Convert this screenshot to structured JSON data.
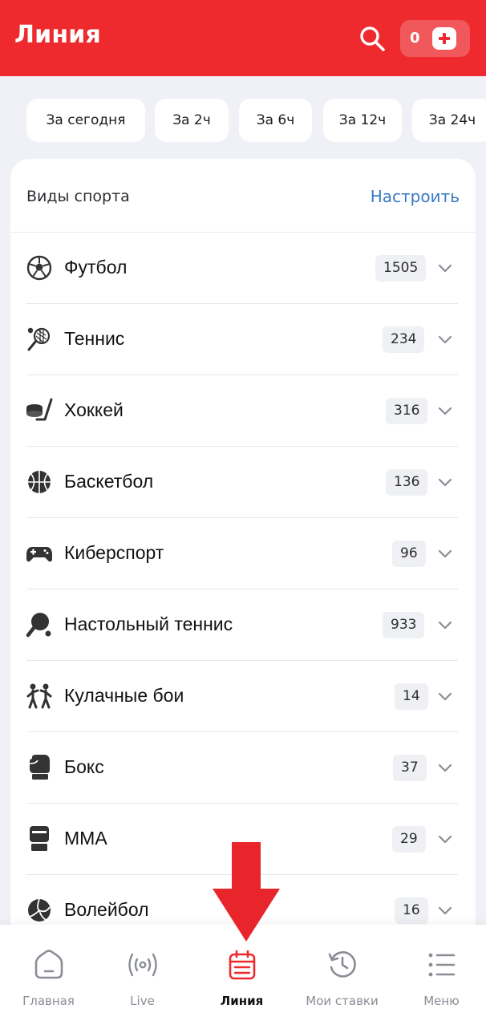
{
  "header": {
    "title": "Линия",
    "balance": "0",
    "accent_color": "#ee2a2e"
  },
  "filters": [
    {
      "label": "За сегодня"
    },
    {
      "label": "За 2ч"
    },
    {
      "label": "За 6ч"
    },
    {
      "label": "За 12ч"
    },
    {
      "label": "За 24ч"
    }
  ],
  "sports_card": {
    "title": "Виды спорта",
    "configure_label": "Настроить",
    "items": [
      {
        "name": "Футбол",
        "count": "1505",
        "icon": "soccer-ball-icon"
      },
      {
        "name": "Теннис",
        "count": "234",
        "icon": "tennis-racket-icon"
      },
      {
        "name": "Хоккей",
        "count": "316",
        "icon": "hockey-icon"
      },
      {
        "name": "Баскетбол",
        "count": "136",
        "icon": "basketball-icon"
      },
      {
        "name": "Киберспорт",
        "count": "96",
        "icon": "gamepad-icon"
      },
      {
        "name": "Настольный теннис",
        "count": "933",
        "icon": "table-tennis-icon"
      },
      {
        "name": "Кулачные бои",
        "count": "14",
        "icon": "fighters-icon"
      },
      {
        "name": "Бокс",
        "count": "37",
        "icon": "boxing-glove-icon"
      },
      {
        "name": "ММА",
        "count": "29",
        "icon": "mma-glove-icon"
      },
      {
        "name": "Волейбол",
        "count": "16",
        "icon": "volleyball-icon"
      }
    ]
  },
  "bottom_nav": [
    {
      "label": "Главная",
      "icon": "home-icon"
    },
    {
      "label": "Live",
      "icon": "live-broadcast-icon"
    },
    {
      "label": "Линия",
      "icon": "calendar-icon",
      "active": true
    },
    {
      "label": "Мои ставки",
      "icon": "history-clock-icon"
    },
    {
      "label": "Меню",
      "icon": "menu-list-icon"
    }
  ]
}
